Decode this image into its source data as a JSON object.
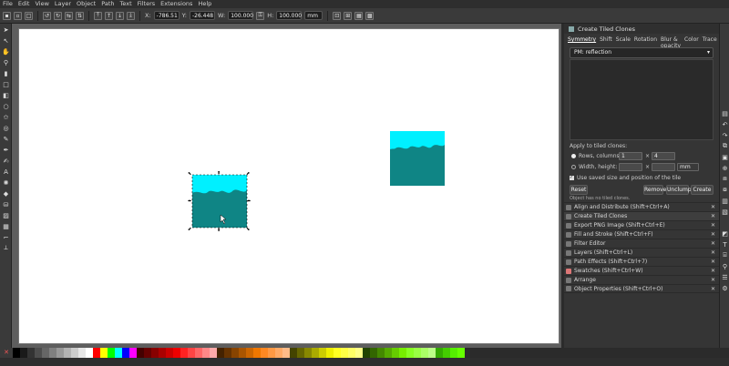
{
  "menu": [
    "File",
    "Edit",
    "View",
    "Layer",
    "Object",
    "Path",
    "Text",
    "Filters",
    "Extensions",
    "Help"
  ],
  "toolbar": {
    "x_label": "X:",
    "x_value": "-786.51",
    "y_label": "Y:",
    "y_value": "-26.448",
    "w_label": "W:",
    "w_value": "100.000",
    "h_label": "H:",
    "h_value": "100.000",
    "unit": "mm"
  },
  "panel": {
    "title": "Create Tiled Clones",
    "tabs": [
      "Symmetry",
      "Shift",
      "Scale",
      "Rotation",
      "Blur & opacity",
      "Color",
      "Trace"
    ],
    "symmetry_value": "PM: reflection",
    "apply_label": "Apply to tiled clones:",
    "rows_cols_label": "Rows, columns:",
    "rows_value": "1",
    "times": "×",
    "cols_value": "4",
    "width_height_label": "Width, height:",
    "unit": "mm",
    "use_saved_label": "Use saved size and position of the tile",
    "reset_label": "Reset",
    "remove_label": "Remove",
    "unclump_label": "Unclump",
    "create_label": "Create",
    "status": "Object has no tiled clones."
  },
  "docked": [
    "Align and Distribute (Shift+Ctrl+A)",
    "Create Tiled Clones",
    "Export PNG Image (Shift+Ctrl+E)",
    "Fill and Stroke (Shift+Ctrl+F)",
    "Filter Editor",
    "Layers (Shift+Ctrl+L)",
    "Path Effects  (Shift+Ctrl+7)",
    "Swatches (Shift+Ctrl+W)",
    "Arrange",
    "Object Properties (Shift+Ctrl+O)"
  ],
  "colors": {
    "cyan": "#00f0ff",
    "teal": "#0f8585",
    "canvas": "#ffffff"
  }
}
